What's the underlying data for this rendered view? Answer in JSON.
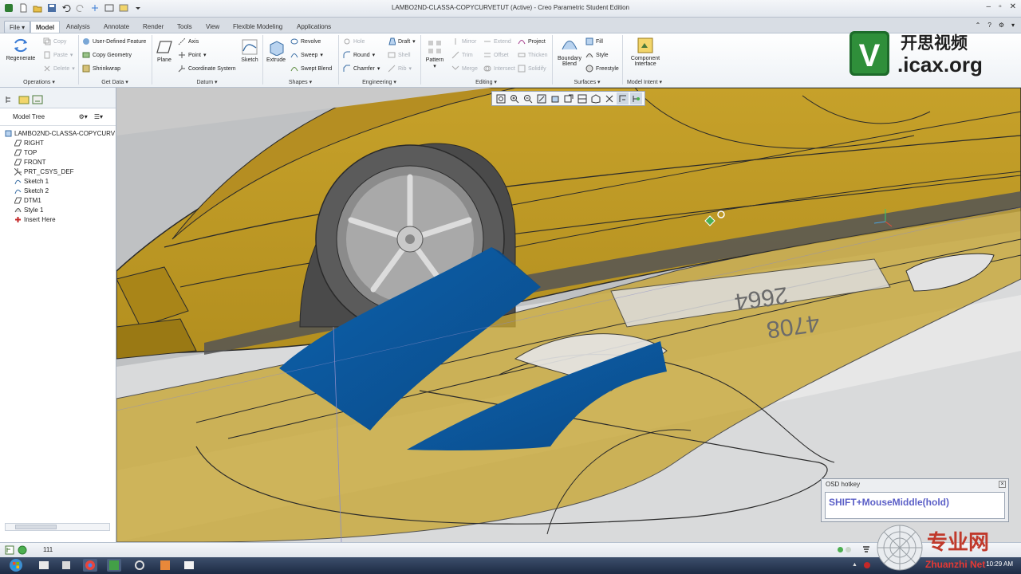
{
  "window": {
    "title": "LAMBO2ND-CLASSA-COPYCURVETUT (Active) - Creo Parametric Student Edition"
  },
  "menu": {
    "tabs": [
      "File",
      "Model",
      "Analysis",
      "Annotate",
      "Render",
      "Tools",
      "View",
      "Flexible Modeling",
      "Applications"
    ],
    "active": "Model"
  },
  "ribbon": {
    "operations": {
      "regenerate": "Regenerate",
      "copy": "Copy",
      "paste": "Paste",
      "delete": "Delete",
      "group": "Operations"
    },
    "get_data": {
      "udf": "User-Defined Feature",
      "copy_geometry": "Copy Geometry",
      "shrinkwrap": "Shrinkwrap",
      "group": "Get Data"
    },
    "datum": {
      "plane": "Plane",
      "axis": "Axis",
      "point": "Point",
      "csys": "Coordinate System",
      "sketch": "Sketch",
      "group": "Datum"
    },
    "shapes": {
      "extrude": "Extrude",
      "revolve": "Revolve",
      "sweep": "Sweep",
      "swept_blend": "Swept Blend",
      "group": "Shapes"
    },
    "engineering": {
      "hole": "Hole",
      "round": "Round",
      "chamfer": "Chamfer",
      "draft": "Draft",
      "shell": "Shell",
      "rib": "Rib",
      "group": "Engineering"
    },
    "editing": {
      "pattern": "Pattern",
      "mirror": "Mirror",
      "trim": "Trim",
      "merge": "Merge",
      "extend": "Extend",
      "offset": "Offset",
      "intersect": "Intersect",
      "project": "Project",
      "thicken": "Thicken",
      "solidify": "Solidify",
      "group": "Editing"
    },
    "surfaces": {
      "boundary_blend_1": "Boundary",
      "boundary_blend_2": "Blend",
      "fill": "Fill",
      "style": "Style",
      "freestyle": "Freestyle",
      "group": "Surfaces"
    },
    "model_intent": {
      "component_1": "Component",
      "component_2": "Interface",
      "group": "Model Intent"
    }
  },
  "logo": {
    "cn": "开思视频",
    "site": ".icax.org",
    "letter": "V"
  },
  "model_tree": {
    "header": "Model Tree",
    "items": [
      {
        "label": "LAMBO2ND-CLASSA-COPYCURV",
        "icon": "part-icon"
      },
      {
        "label": "RIGHT",
        "icon": "datum-plane-icon"
      },
      {
        "label": "TOP",
        "icon": "datum-plane-icon"
      },
      {
        "label": "FRONT",
        "icon": "datum-plane-icon"
      },
      {
        "label": "PRT_CSYS_DEF",
        "icon": "csys-icon"
      },
      {
        "label": "Sketch 1",
        "icon": "sketch-icon"
      },
      {
        "label": "Sketch 2",
        "icon": "sketch-icon"
      },
      {
        "label": "DTM1",
        "icon": "datum-plane-icon"
      },
      {
        "label": "Style 1",
        "icon": "style-icon"
      },
      {
        "label": "Insert Here",
        "icon": "insert-arrow-icon"
      }
    ]
  },
  "viewport": {
    "plate_top": "2664",
    "plate_bottom": "4708"
  },
  "osd": {
    "title": "OSD hotkey",
    "text": "SHIFT+MouseMiddle(hold)"
  },
  "status": {
    "count": "111"
  },
  "taskbar": {
    "time": "10:29 AM"
  },
  "watermark": {
    "cn": "专业网",
    "site": "Zhuanzhi Net"
  },
  "colors": {
    "body": "#c9a630",
    "surface": "#0f5598",
    "ribbon": "#eef2f6"
  }
}
